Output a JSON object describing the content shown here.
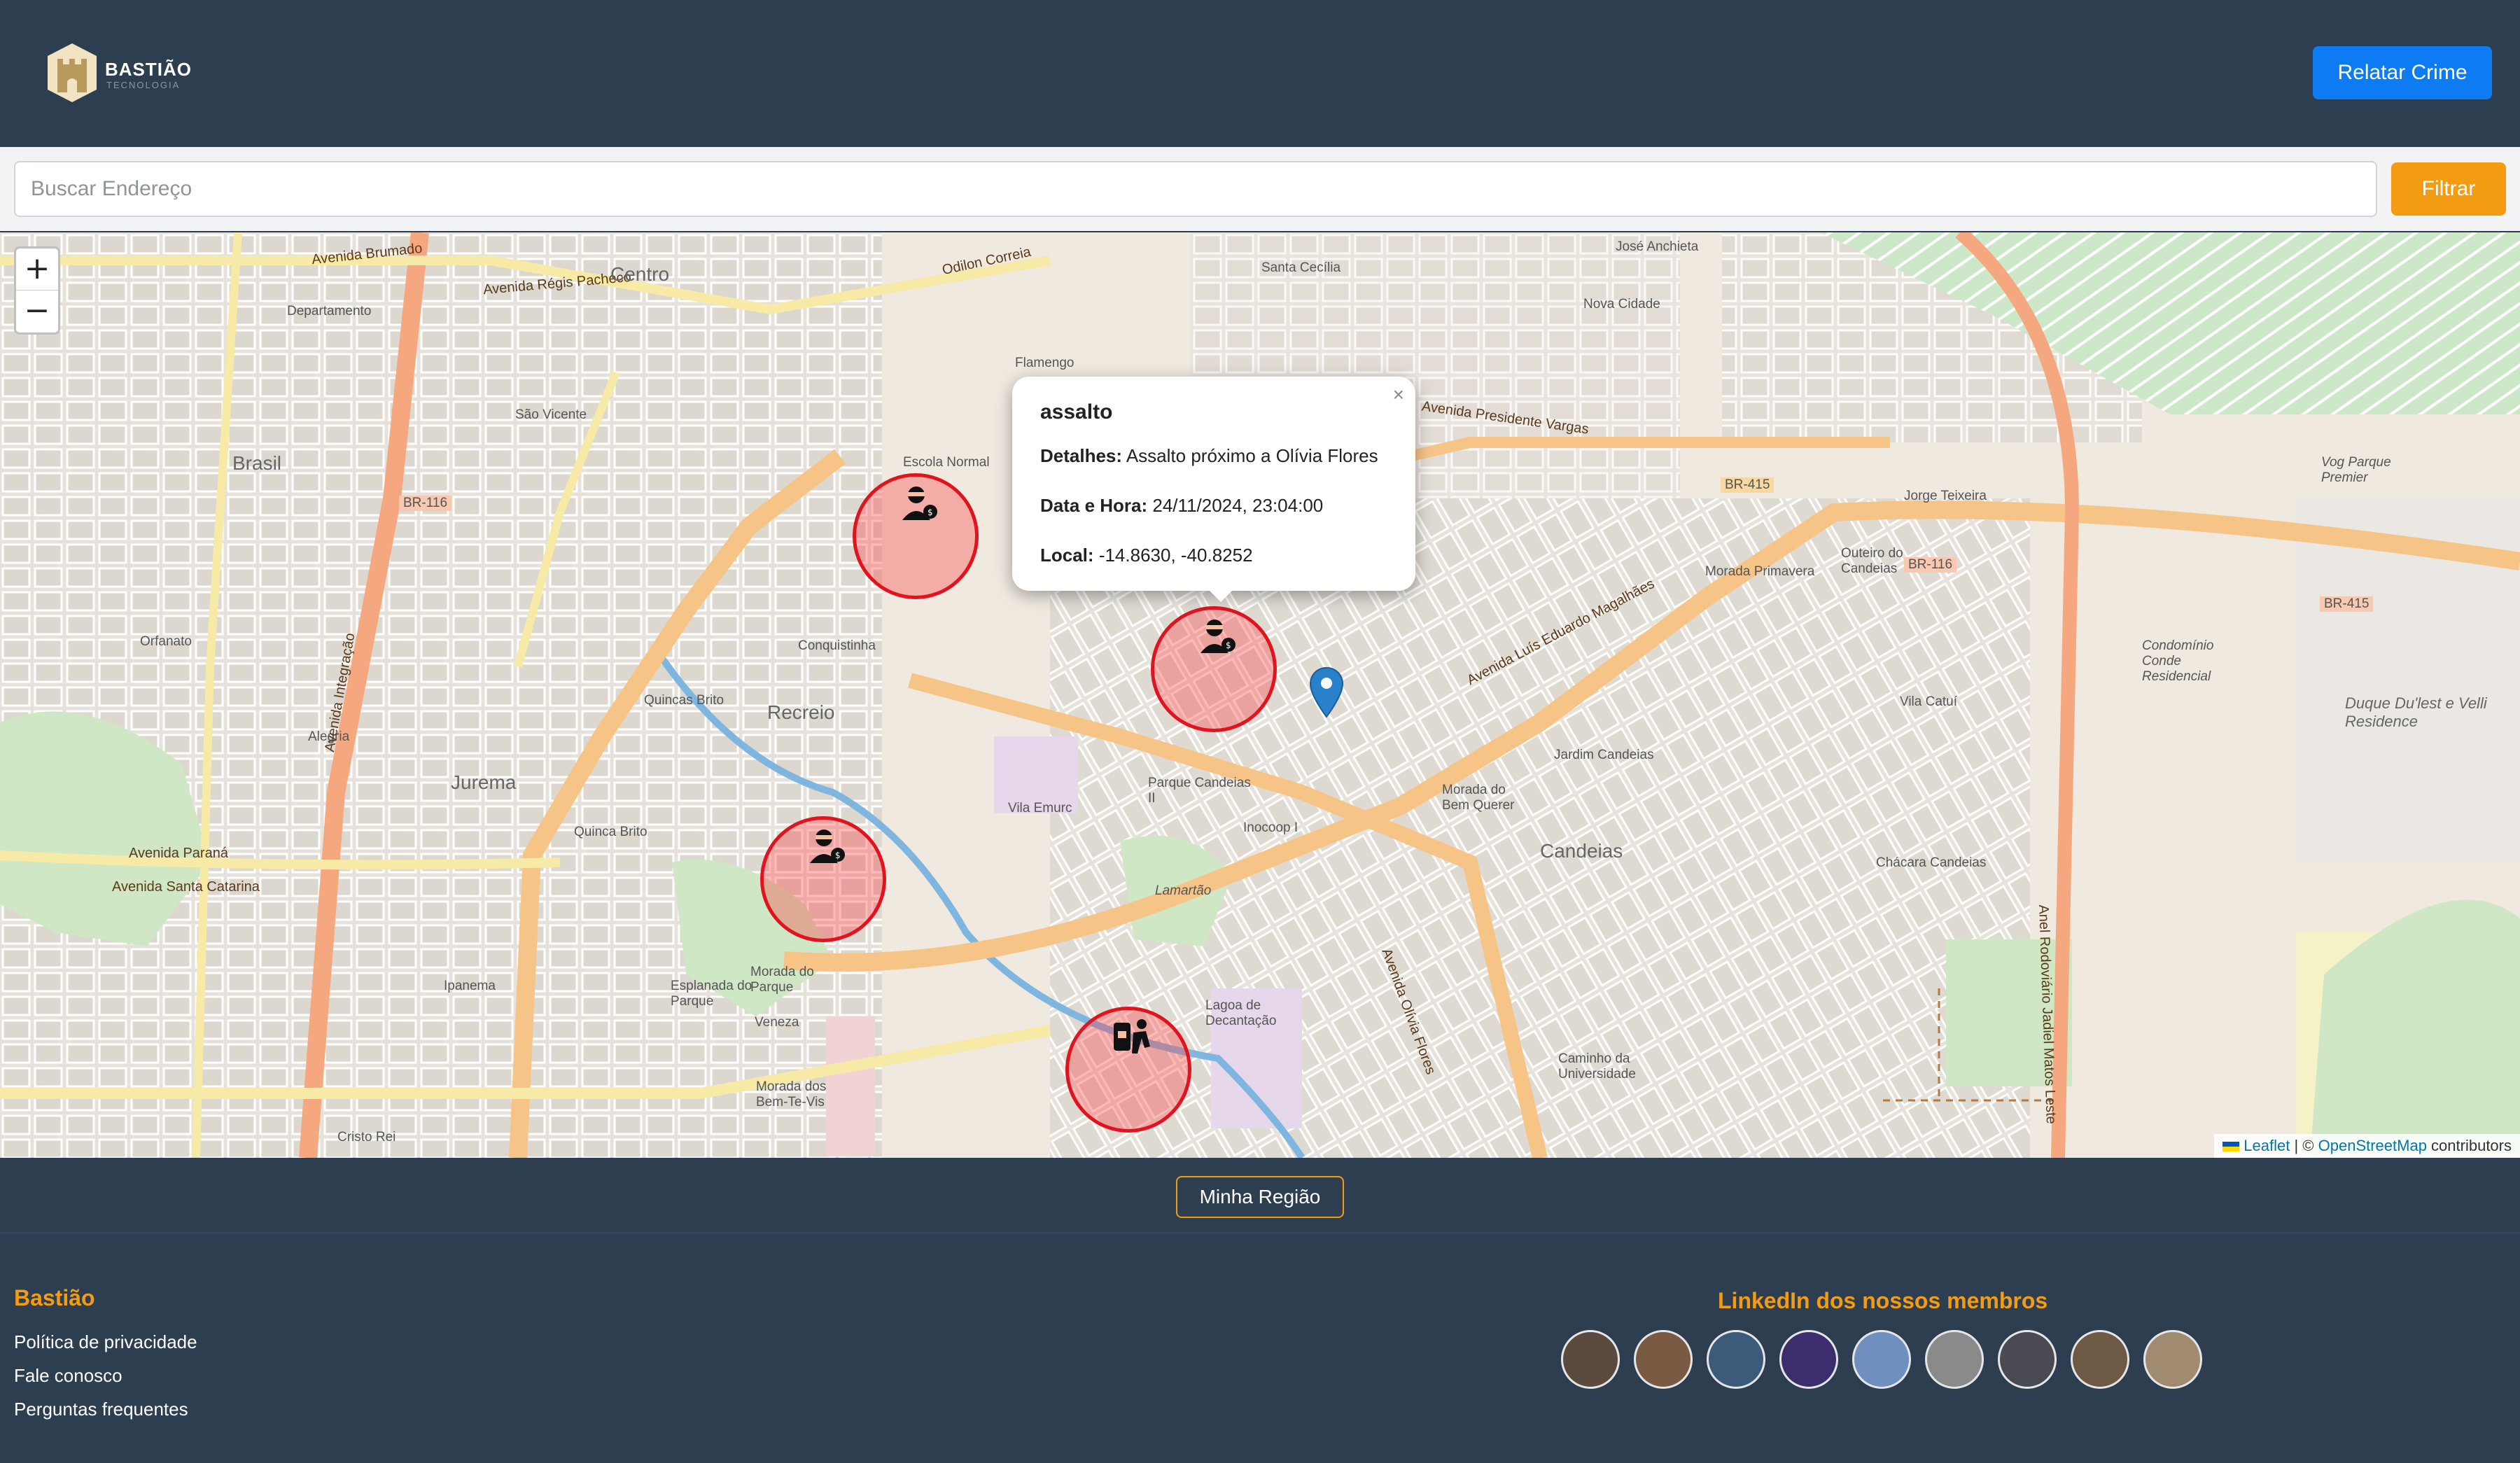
{
  "header": {
    "logo_name": "BASTIÃO",
    "logo_sub": "TECNOLOGIA",
    "report_button": "Relatar Crime"
  },
  "search": {
    "placeholder": "Buscar Endereço",
    "filter_button": "Filtrar"
  },
  "map": {
    "zoom_in": "+",
    "zoom_out": "−",
    "labels": {
      "avenida_brumado": "Avenida Brumado",
      "avenida_regis_pacheco": "Avenida Régis Pacheco",
      "centro": "Centro",
      "odilon_correia": "Odilon Correia",
      "santa_cecilia": "Santa Cecília",
      "jose_anchieta": "José Anchieta",
      "nova_cidade": "Nova Cidade",
      "departamento": "Departamento",
      "sao_vicente": "São Vicente",
      "brasil": "Brasil",
      "escola_normal": "Escola Normal",
      "flamengo": "Flamengo",
      "avenida_presidente_vargas": "Avenida Presidente Vargas",
      "br415": "BR-415",
      "br116": "BR-116",
      "jorge_teixeira": "Jorge Teixeira",
      "vog_parque_premier": "Vog Parque Premier",
      "morada_primavera": "Morada Primavera",
      "outeiro_candeias": "Outeiro do Candeias",
      "avenida_luis_eduardo_magalhaes": "Avenida Luís Eduardo Magalhães",
      "conquistinha": "Conquistinha",
      "quincas_brito": "Quincas Brito",
      "recreio": "Recreio",
      "orfanato": "Orfanato",
      "alegria": "Alegria",
      "jurema": "Jurema",
      "parque_candeias": "Parque Candeias II",
      "vila_emurc": "Vila Emurc",
      "inocoop": "Inocoop I",
      "vila_catui": "Vila Catuí",
      "jardim_candeias": "Jardim Candeias",
      "candeias": "Candeias",
      "chacara_candeias": "Chácara Candeias",
      "condominio_conde": "Condomínio Conde Residencial",
      "duque_dulest": "Duque Du'lest e Velli Residence",
      "morada_bem_querer": "Morada do Bem Querer",
      "avenida_parana": "Avenida Paraná",
      "avenida_santa_catarina": "Avenida Santa Catarina",
      "quinca_brito": "Quinca Brito",
      "esplanada": "Esplanada do Parque",
      "morada_parque": "Morada do Parque",
      "veneza": "Veneza",
      "lamartao": "Lamartão",
      "lagoa_decantacao": "Lagoa de Decantação",
      "caminho_universidade": "Caminho da Universidade",
      "morada_bem_te_vis": "Morada dos Bem-Te-Vis",
      "ipanema": "Ipanema",
      "cristo_rei": "Cristo Rei",
      "avenida_integracao": "Avenida Integração",
      "avenida_olivia_flores": "Avenida Olívia Flores",
      "anel_rodoviario": "Anel Rodoviário Jadiel Matos Leste"
    },
    "attribution_leaflet": "Leaflet",
    "attribution_sep": " | © ",
    "attribution_osm": "OpenStreetMap",
    "attribution_tail": " contributors"
  },
  "popup": {
    "close": "×",
    "title": "assalto",
    "details_label": "Detalhes:",
    "details_value": "Assalto próximo a Olívia Flores",
    "datetime_label": "Data e Hora:",
    "datetime_value": "24/11/2024, 23:04:00",
    "location_label": "Local:",
    "location_value": "-14.8630, -40.8252"
  },
  "region_button": "Minha Região",
  "footer": {
    "brand": "Bastião",
    "links": [
      "Política de privacidade",
      "Fale conosco",
      "Perguntas frequentes"
    ],
    "members_title": "LinkedIn dos nossos membros",
    "member_count": 9
  },
  "colors": {
    "header_bg": "#2c3e50",
    "primary_button": "#0d7cf2",
    "accent_orange": "#f39c12",
    "crime_marker": "#e0141e"
  }
}
